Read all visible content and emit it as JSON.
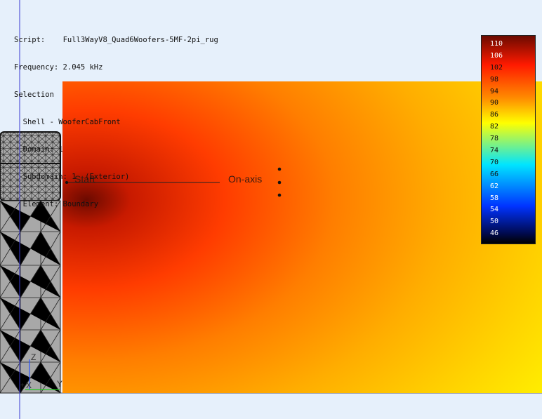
{
  "info": {
    "script_label": "Script:",
    "script_value": "Full3WayV8_Quad6Woofers-5MF-2pi_rug",
    "frequency_label": "Frequency:",
    "frequency_value": "2.045 kHz",
    "selection_label": "Selection",
    "shell": "Shell - WooferCabFront",
    "domain": "Domain: 1",
    "subdomain": "Subdomain: 1  (Exterior)",
    "element": "Element: Boundary"
  },
  "plot": {
    "start_label": "Start",
    "onaxis_label": "On-axis"
  },
  "axes": {
    "x_label": "X",
    "y_label": "Y",
    "z_label": "Z"
  },
  "legend": {
    "values": [
      "110",
      "106",
      "102",
      "98",
      "94",
      "90",
      "86",
      "82",
      "78",
      "74",
      "70",
      "66",
      "62",
      "58",
      "54",
      "50",
      "46"
    ],
    "colors": {
      "high": "#6b0a00",
      "red": "#ff1a00",
      "orange": "#ff8c00",
      "yellow": "#ffff00",
      "cyan": "#00e5ff",
      "blue": "#0033ff",
      "navy": "#000a50"
    }
  }
}
